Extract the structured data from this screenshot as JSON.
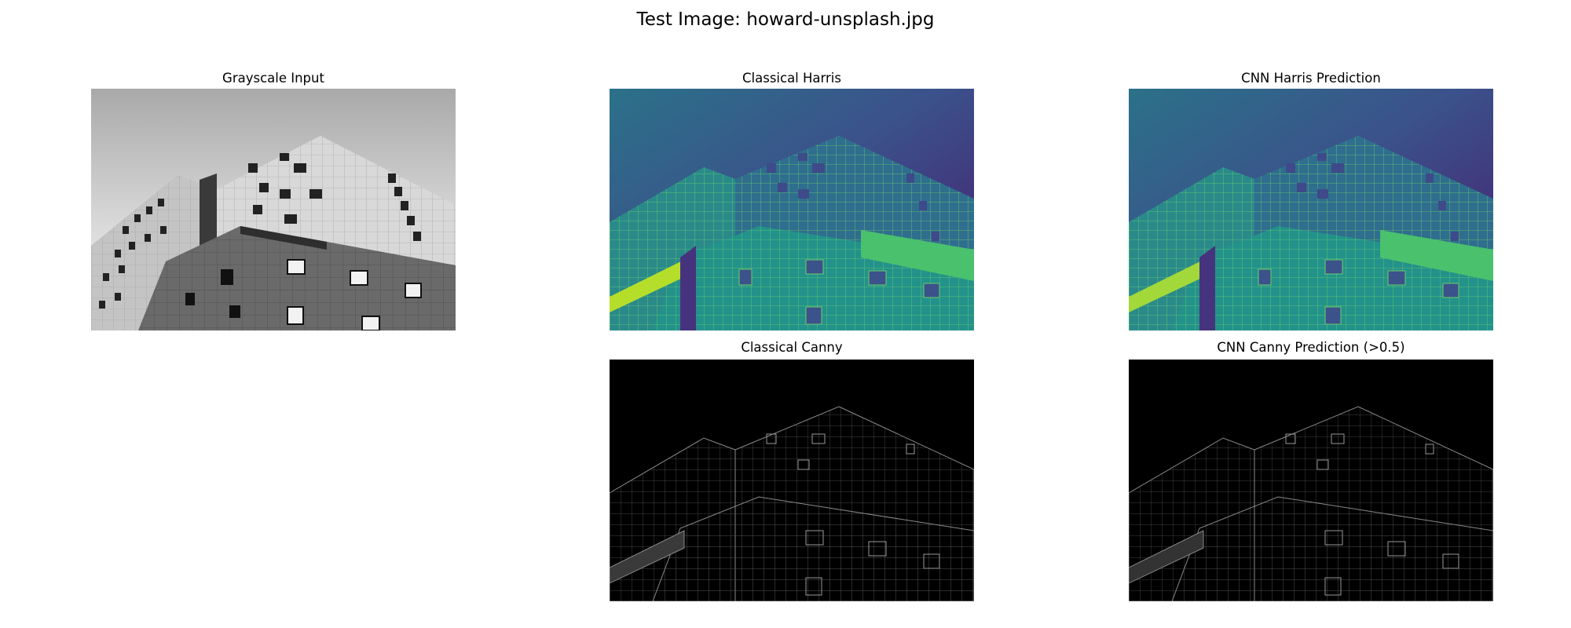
{
  "figure": {
    "title": "Test Image: howard-unsplash.jpg"
  },
  "panels": {
    "grayscale": {
      "title": "Grayscale Input"
    },
    "harris_classical": {
      "title": "Classical Harris"
    },
    "harris_cnn": {
      "title": "CNN Harris Prediction"
    },
    "canny_classical": {
      "title": "Classical Canny"
    },
    "canny_cnn": {
      "title": "CNN Canny Prediction (>0.5)"
    }
  },
  "colors": {
    "viridis_dark": "#440154",
    "viridis_blue": "#31688e",
    "viridis_teal": "#21918c",
    "viridis_green": "#35b779",
    "viridis_yellow": "#b5de2b",
    "canny_bg": "#000000",
    "canny_edge": "#8a8a8a"
  }
}
